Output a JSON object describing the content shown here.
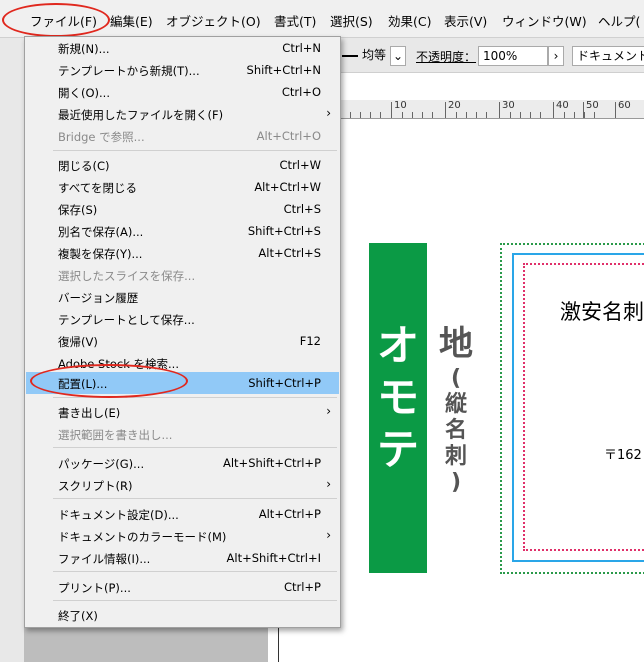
{
  "menubar": {
    "items": [
      "ファイル(F)",
      "編集(E)",
      "オブジェクト(O)",
      "書式(T)",
      "選択(S)",
      "効果(C)",
      "表示(V)",
      "ウィンドウ(W)",
      "ヘルプ("
    ]
  },
  "toolbar": {
    "stroke_style": "均等",
    "opacity_label": "不透明度：",
    "opacity_value": "100%",
    "document_label": "ドキュメント"
  },
  "ruler": {
    "labels": [
      "10",
      "20",
      "30",
      "40",
      "50",
      "60"
    ]
  },
  "file_menu": {
    "items": [
      {
        "label": "新規(N)...",
        "shortcut": "Ctrl+N"
      },
      {
        "label": "テンプレートから新規(T)...",
        "shortcut": "Shift+Ctrl+N"
      },
      {
        "label": "開く(O)...",
        "shortcut": "Ctrl+O"
      },
      {
        "label": "最近使用したファイルを開く(F)",
        "shortcut": ""
      },
      {
        "label": "Bridge で参照...",
        "shortcut": "Alt+Ctrl+O"
      },
      {
        "label": "閉じる(C)",
        "shortcut": "Ctrl+W"
      },
      {
        "label": "すべてを閉じる",
        "shortcut": "Alt+Ctrl+W"
      },
      {
        "label": "保存(S)",
        "shortcut": "Ctrl+S"
      },
      {
        "label": "別名で保存(A)...",
        "shortcut": "Shift+Ctrl+S"
      },
      {
        "label": "複製を保存(Y)...",
        "shortcut": "Alt+Ctrl+S"
      },
      {
        "label": "選択したスライスを保存...",
        "shortcut": ""
      },
      {
        "label": "バージョン履歴",
        "shortcut": ""
      },
      {
        "label": "テンプレートとして保存...",
        "shortcut": ""
      },
      {
        "label": "復帰(V)",
        "shortcut": "F12"
      },
      {
        "label": "Adobe Stock を検索...",
        "shortcut": ""
      },
      {
        "label": "配置(L)...",
        "shortcut": "Shift+Ctrl+P"
      },
      {
        "label": "書き出し(E)",
        "shortcut": ""
      },
      {
        "label": "選択範囲を書き出し...",
        "shortcut": ""
      },
      {
        "label": "パッケージ(G)...",
        "shortcut": "Alt+Shift+Ctrl+P"
      },
      {
        "label": "スクリプト(R)",
        "shortcut": ""
      },
      {
        "label": "ドキュメント設定(D)...",
        "shortcut": "Alt+Ctrl+P"
      },
      {
        "label": "ドキュメントのカラーモード(M)",
        "shortcut": ""
      },
      {
        "label": "ファイル情報(I)...",
        "shortcut": "Alt+Shift+Ctrl+I"
      },
      {
        "label": "プリント(P)...",
        "shortcut": "Ctrl+P"
      },
      {
        "label": "終了(X)",
        "shortcut": ""
      }
    ]
  },
  "artboard": {
    "banner_text": [
      "オ",
      "モ",
      "テ"
    ],
    "side_title": "地",
    "side_sub": [
      "(",
      "縦",
      "名",
      "刺",
      ")"
    ],
    "card_title": "激安名刺",
    "card_address": "〒162"
  },
  "colors": {
    "highlight": "#91c9f7",
    "annotation_ring": "#e0281e",
    "banner_green": "#0b9a45"
  }
}
